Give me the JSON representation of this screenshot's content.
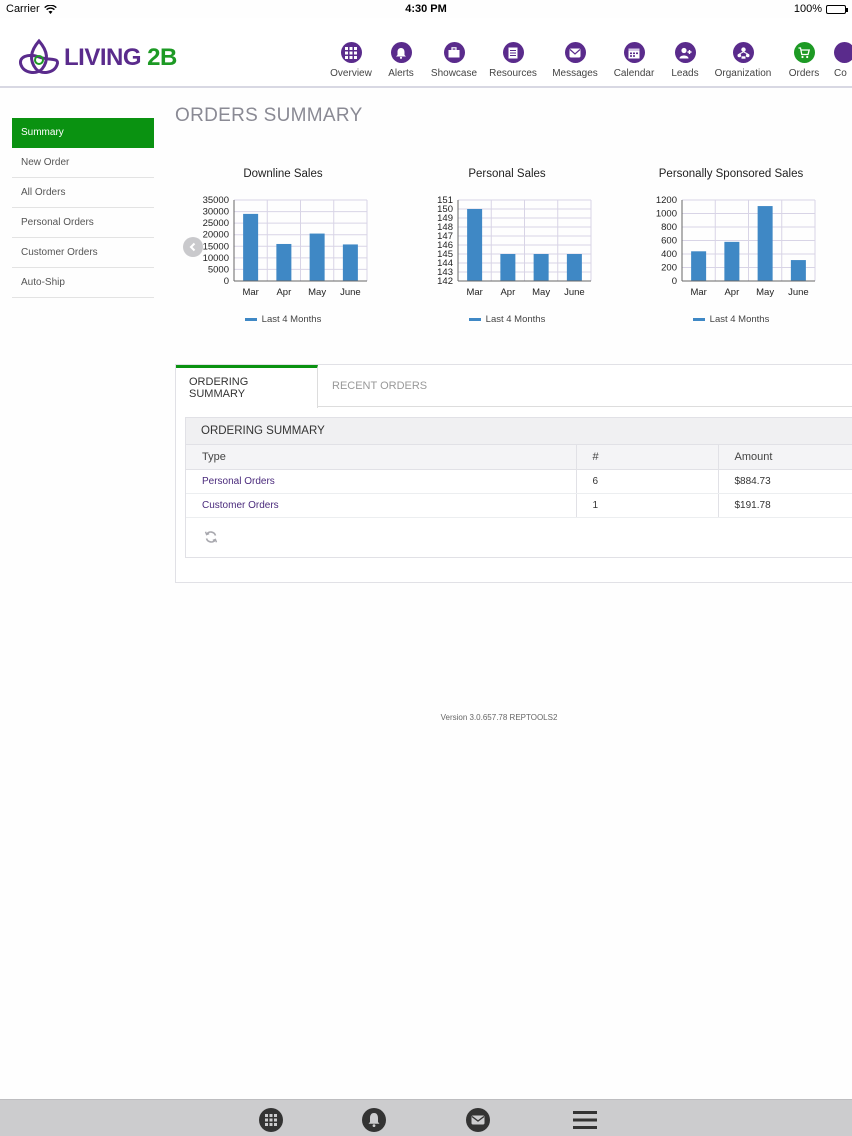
{
  "status_bar": {
    "carrier": "Carrier",
    "time": "4:30 PM",
    "battery": "100%"
  },
  "brand": {
    "logo_text_1": "LIVING",
    "logo_text_2": " 2B",
    "primary_color": "#5a2b8c",
    "accent_color": "#1d9a24"
  },
  "nav": {
    "items": [
      {
        "label": "Overview",
        "icon": "grid-icon"
      },
      {
        "label": "Alerts",
        "icon": "bell-icon"
      },
      {
        "label": "Showcase",
        "icon": "briefcase-icon"
      },
      {
        "label": "Resources",
        "icon": "document-icon"
      },
      {
        "label": "Messages",
        "icon": "envelope-icon"
      },
      {
        "label": "Calendar",
        "icon": "calendar-icon"
      },
      {
        "label": "Leads",
        "icon": "add-user-icon"
      },
      {
        "label": "Organization",
        "icon": "org-chart-icon"
      },
      {
        "label": "Orders",
        "icon": "cart-icon",
        "active": true
      },
      {
        "label": "Co",
        "icon": "more-icon"
      }
    ]
  },
  "sidebar": {
    "items": [
      {
        "label": "Summary",
        "active": true
      },
      {
        "label": "New Order"
      },
      {
        "label": "All Orders"
      },
      {
        "label": "Personal Orders"
      },
      {
        "label": "Customer Orders"
      },
      {
        "label": "Auto-Ship"
      }
    ]
  },
  "page": {
    "title": "ORDERS SUMMARY"
  },
  "chart_data": [
    {
      "type": "bar",
      "title": "Downline Sales",
      "categories": [
        "Mar",
        "Apr",
        "May",
        "June"
      ],
      "series": [
        {
          "name": "Last 4 Months",
          "values": [
            29000,
            16000,
            20500,
            15800
          ]
        }
      ],
      "ylim": [
        0,
        35000
      ],
      "yticks": [
        0,
        5000,
        10000,
        15000,
        20000,
        25000,
        30000,
        35000
      ],
      "grid": true,
      "legend": "bottom",
      "color": "#3f88c5"
    },
    {
      "type": "bar",
      "title": "Personal Sales",
      "categories": [
        "Mar",
        "Apr",
        "May",
        "June"
      ],
      "series": [
        {
          "name": "Last 4 Months",
          "values": [
            150,
            145,
            145,
            145
          ]
        }
      ],
      "ylim": [
        142,
        151
      ],
      "yticks": [
        142,
        143,
        144,
        145,
        146,
        147,
        148,
        149,
        150,
        151
      ],
      "grid": true,
      "legend": "bottom",
      "color": "#3f88c5"
    },
    {
      "type": "bar",
      "title": "Personally Sponsored Sales",
      "categories": [
        "Mar",
        "Apr",
        "May",
        "June"
      ],
      "series": [
        {
          "name": "Last 4 Months",
          "values": [
            440,
            580,
            1110,
            310
          ]
        }
      ],
      "ylim": [
        0,
        1200
      ],
      "yticks": [
        0,
        200,
        400,
        600,
        800,
        1000,
        1200
      ],
      "grid": true,
      "legend": "bottom",
      "color": "#3f88c5"
    }
  ],
  "tabs": {
    "active": "ORDERING SUMMARY",
    "inactive": "RECENT ORDERS"
  },
  "summary": {
    "heading": "ORDERING SUMMARY",
    "columns": [
      "Type",
      "#",
      "Amount"
    ],
    "rows": [
      {
        "type": "Personal Orders",
        "count": "6",
        "amount": "$884.73"
      },
      {
        "type": "Customer Orders",
        "count": "1",
        "amount": "$191.78"
      }
    ]
  },
  "footer": {
    "version": "Version 3.0.657.78 REPTOOLS2"
  }
}
